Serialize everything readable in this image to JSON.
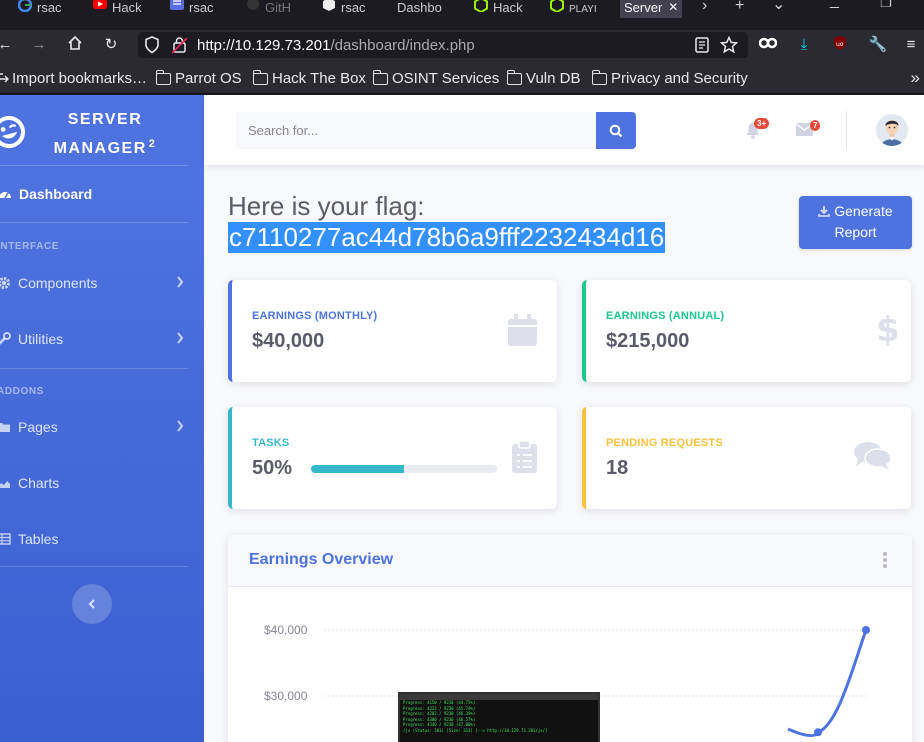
{
  "browser": {
    "tabs": [
      {
        "label": "rsac",
        "icon": "google-icon"
      },
      {
        "label": "Hack",
        "icon": "youtube-icon"
      },
      {
        "label": "rsac",
        "icon": "page-icon"
      },
      {
        "label": "GitH",
        "icon": "github-icon"
      },
      {
        "label": "rsac",
        "icon": "cube-icon"
      },
      {
        "label": "Dashbo",
        "icon": "none"
      },
      {
        "label": "Hack",
        "icon": "htb-icon"
      },
      {
        "label": "PLAYI",
        "icon": "htb-icon"
      },
      {
        "label": "Server",
        "icon": "none",
        "active": true
      }
    ],
    "url_host": "http://10.129.73.201",
    "url_path": "/dashboard/index.php",
    "bookmarks": [
      "Import bookmarks…",
      "Parrot OS",
      "Hack The Box",
      "OSINT Services",
      "Vuln DB",
      "Privacy and Security"
    ],
    "colors": {
      "chrome_dark": "#1c1b22",
      "chrome": "#2b2a33",
      "urlbar": "#1c1b22"
    }
  },
  "sidebar": {
    "brand": {
      "line1": "Server",
      "line2": "Manager",
      "sup": "2"
    },
    "items": [
      {
        "label": "Dashboard",
        "icon": "tachometer-icon",
        "active": true
      },
      {
        "label": "Components",
        "icon": "gear-icon",
        "chevron": true
      },
      {
        "label": "Utilities",
        "icon": "wrench-icon",
        "chevron": true
      },
      {
        "label": "Pages",
        "icon": "folder-icon",
        "chevron": true
      },
      {
        "label": "Charts",
        "icon": "area-chart-icon"
      },
      {
        "label": "Tables",
        "icon": "table-icon"
      }
    ],
    "headings": [
      "Interface",
      "Addons"
    ]
  },
  "topbar": {
    "search_placeholder": "Search for...",
    "alerts_badge": "3+",
    "messages_badge": "7"
  },
  "main": {
    "heading": "Here is your flag:",
    "flag": "c7110277ac44d78b6a9fff2232434d16",
    "generate_report": {
      "line1": "Generate",
      "line2": "Report"
    },
    "cards": [
      {
        "label": "Earnings (Monthly)",
        "value": "$40,000",
        "color": "#4e73df",
        "icon": "calendar-icon"
      },
      {
        "label": "Earnings (Annual)",
        "value": "$215,000",
        "color": "#1cc88a",
        "icon": "dollar-icon"
      },
      {
        "label": "Tasks",
        "value": "50%",
        "color": "#36b9cc",
        "icon": "clipboard-icon",
        "progress": 0.5
      },
      {
        "label": "Pending Requests",
        "value": "18",
        "color": "#f6c23e",
        "icon": "comments-icon"
      }
    ],
    "chart_title": "Earnings Overview"
  },
  "chart_data": {
    "type": "line",
    "title": "Earnings Overview",
    "y_ticks": [
      "$40,000",
      "$30,000"
    ],
    "series": [
      {
        "values": [
          25000,
          24500,
          40000
        ]
      }
    ],
    "ylim": [
      25000,
      40000
    ],
    "color": "#4e73df"
  },
  "terminal": {
    "lines": [
      "Progress: 4150 / 9230 (44.75%)",
      "Progress: 4222 / 9230 (45.74%)",
      "Progress: 4282 / 9230 (46.39%)",
      "Progress: 4300 / 9230 (46.57%)",
      "Progress: 4340 / 9230 (47.00%)",
      "/js                  (Status: 301) [Size: 313] [--> http://10.129.73.201/js/]"
    ]
  }
}
